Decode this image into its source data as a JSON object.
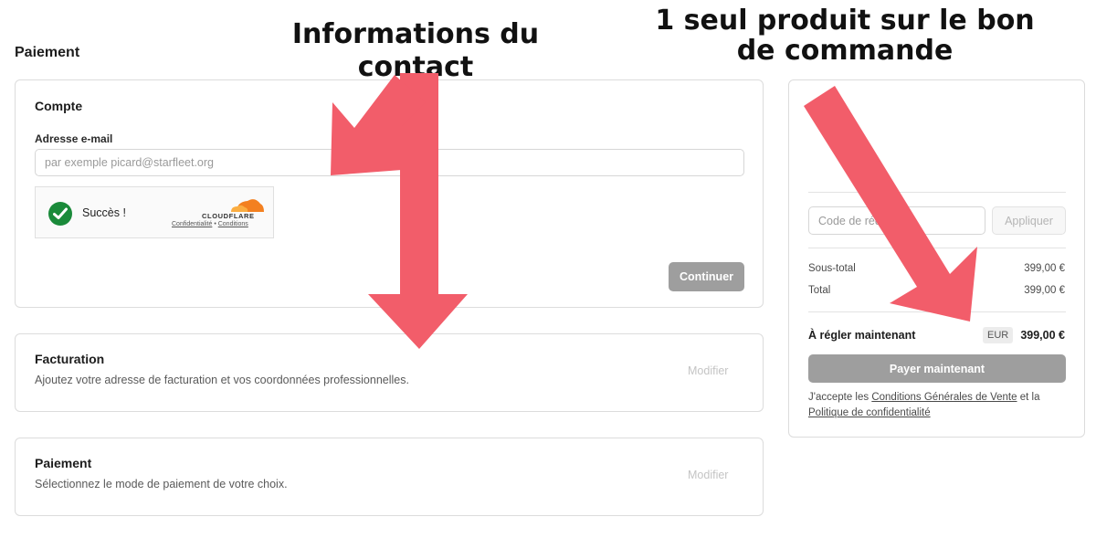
{
  "page_title": "Paiement",
  "account": {
    "title": "Compte",
    "email_label": "Adresse e-mail",
    "email_value": "",
    "email_placeholder": "par exemple picard@starfleet.org",
    "captcha": {
      "status": "Succès !",
      "provider": "CLOUDFLARE",
      "privacy_link": "Confidentialité",
      "separator": "•",
      "terms_link": "Conditions"
    },
    "continue_label": "Continuer"
  },
  "billing": {
    "title": "Facturation",
    "description": "Ajoutez votre adresse de facturation et vos coordonnées professionnelles.",
    "modify_label": "Modifier"
  },
  "payment": {
    "title": "Paiement",
    "description": "Sélectionnez le mode de paiement de votre choix.",
    "modify_label": "Modifier"
  },
  "summary": {
    "promo_placeholder": "Code de réduction",
    "apply_label": "Appliquer",
    "subtotal_label": "Sous-total",
    "subtotal_value": "399,00 €",
    "total_label": "Total",
    "total_value": "399,00 €",
    "due_label": "À régler maintenant",
    "currency": "EUR",
    "due_value": "399,00 €",
    "pay_label": "Payer maintenant",
    "terms_prefix": "J'accepte les ",
    "terms_link": "Conditions Générales de Vente",
    "terms_mid": " et la",
    "privacy_link": "Politique de confidentialité"
  },
  "annotations": {
    "left": "Informations du contact",
    "right": "1 seul produit sur le bon de commande"
  },
  "colors": {
    "arrow": "#f25d6a",
    "success_green": "#1a8a3a",
    "cloudflare_orange": "#f38020",
    "button_gray": "#9e9e9e"
  }
}
